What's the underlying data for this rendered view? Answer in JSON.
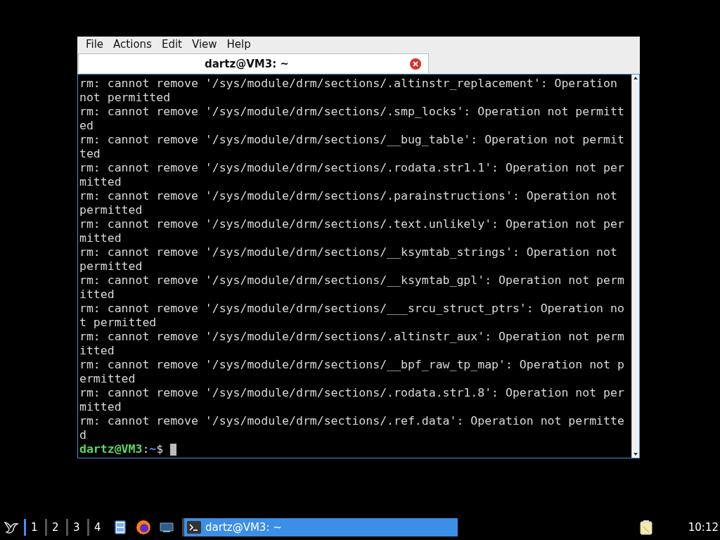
{
  "window": {
    "menu": [
      "File",
      "Actions",
      "Edit",
      "View",
      "Help"
    ],
    "tabs": [
      {
        "label": "dartz@VM3: ~",
        "selected": true
      }
    ],
    "terminal": {
      "lines": [
        "rm: cannot remove '/sys/module/drm/sections/.altinstr_replacement': Operation",
        "not permitted",
        "rm: cannot remove '/sys/module/drm/sections/.smp_locks': Operation not permitt",
        "ed",
        "rm: cannot remove '/sys/module/drm/sections/__bug_table': Operation not permit",
        "ted",
        "rm: cannot remove '/sys/module/drm/sections/.rodata.str1.1': Operation not per",
        "mitted",
        "rm: cannot remove '/sys/module/drm/sections/.parainstructions': Operation not",
        "permitted",
        "rm: cannot remove '/sys/module/drm/sections/.text.unlikely': Operation not per",
        "mitted",
        "rm: cannot remove '/sys/module/drm/sections/__ksymtab_strings': Operation not",
        "permitted",
        "rm: cannot remove '/sys/module/drm/sections/__ksymtab_gpl': Operation not perm",
        "itted",
        "rm: cannot remove '/sys/module/drm/sections/___srcu_struct_ptrs': Operation no",
        "t permitted",
        "rm: cannot remove '/sys/module/drm/sections/.altinstr_aux': Operation not perm",
        "itted",
        "rm: cannot remove '/sys/module/drm/sections/__bpf_raw_tp_map': Operation not p",
        "ermitted",
        "rm: cannot remove '/sys/module/drm/sections/.rodata.str1.8': Operation not per",
        "mitted",
        "rm: cannot remove '/sys/module/drm/sections/.ref.data': Operation not permitte",
        "d"
      ],
      "prompt": {
        "user_host": "dartz@VM3",
        "separator": ":",
        "path": "~",
        "symbol": "$"
      }
    }
  },
  "taskbar": {
    "workspaces": [
      {
        "label": "1",
        "selected": true
      },
      {
        "label": "2",
        "selected": false
      },
      {
        "label": "3",
        "selected": false
      },
      {
        "label": "4",
        "selected": false
      }
    ],
    "launchers": [
      {
        "kind": "files"
      },
      {
        "kind": "browser"
      },
      {
        "kind": "display"
      }
    ],
    "tasks": [
      {
        "label": "dartz@VM3: ~",
        "selected": true
      }
    ],
    "clock": "10:12"
  }
}
